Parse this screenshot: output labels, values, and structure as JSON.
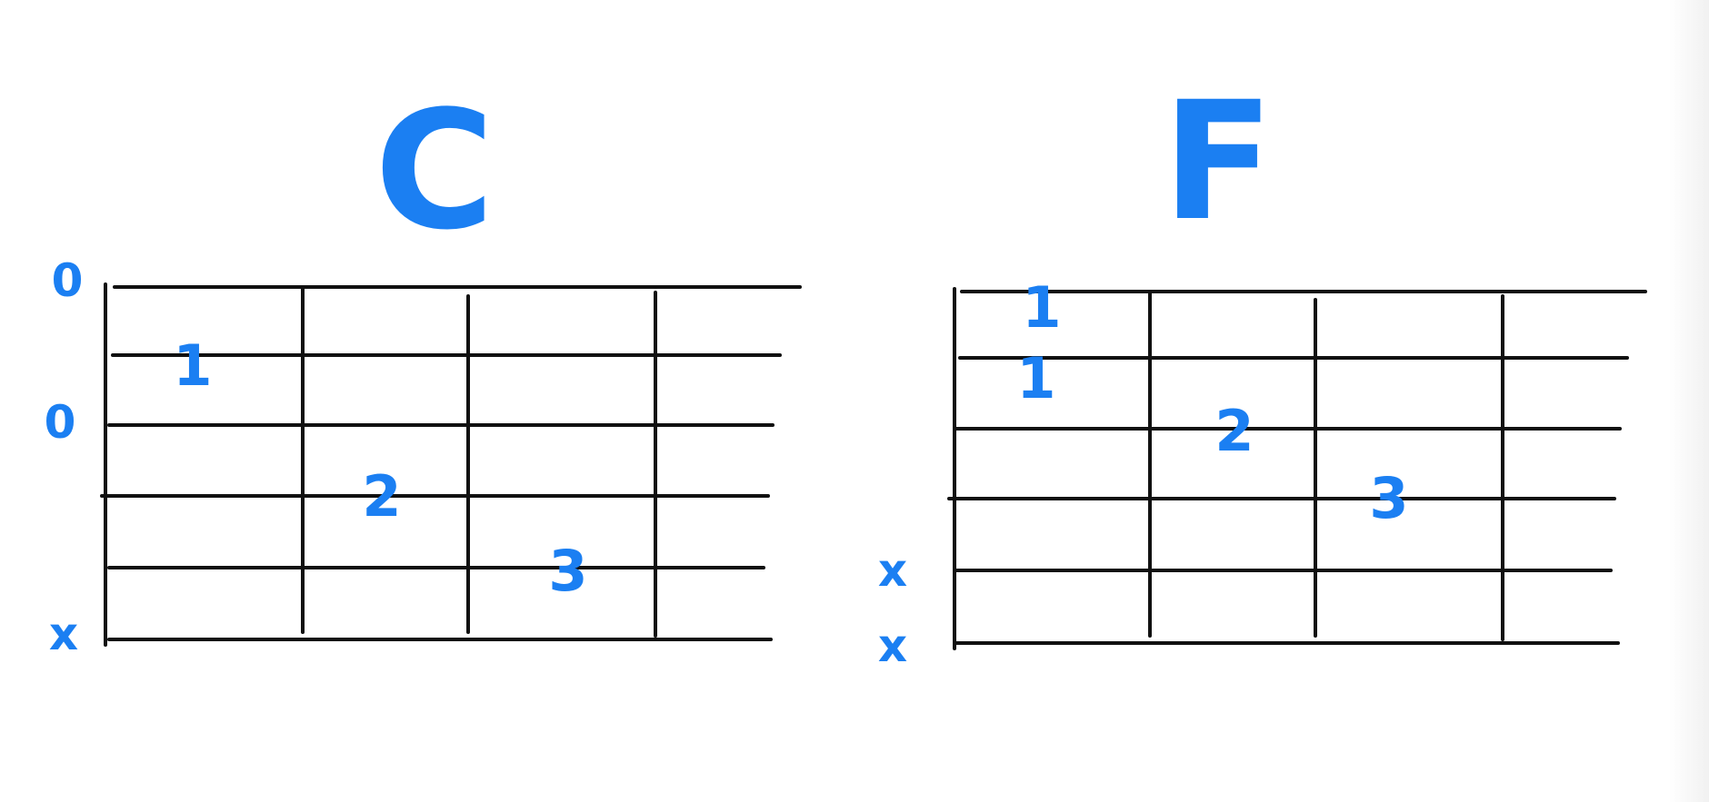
{
  "colors": {
    "ink": "#1b7ff2",
    "grid": "#111111",
    "background": "#ffffff"
  },
  "chords": [
    {
      "name": "C",
      "string_markers": [
        "0",
        "",
        "0",
        "",
        "",
        "x"
      ],
      "fingers": [
        {
          "label": "1",
          "string": 2,
          "fret": 1
        },
        {
          "label": "2",
          "string": 4,
          "fret": 2
        },
        {
          "label": "3",
          "string": 5,
          "fret": 3
        }
      ]
    },
    {
      "name": "F",
      "string_markers": [
        "",
        "",
        "",
        "",
        "x",
        "x"
      ],
      "fingers": [
        {
          "label": "1",
          "string": 1,
          "fret": 1
        },
        {
          "label": "1",
          "string": 2,
          "fret": 1
        },
        {
          "label": "2",
          "string": 3,
          "fret": 2
        },
        {
          "label": "3",
          "string": 4,
          "fret": 3
        }
      ]
    }
  ]
}
